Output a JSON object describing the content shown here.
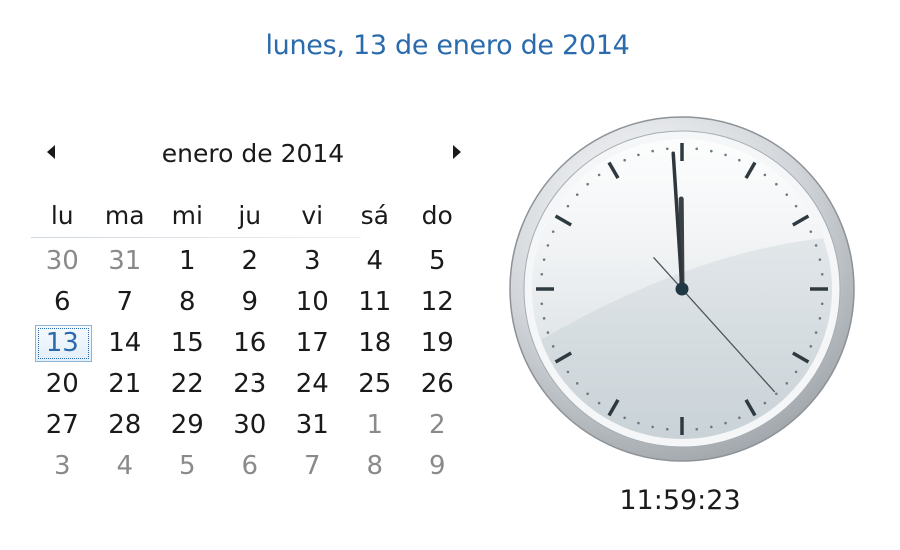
{
  "header": {
    "long_date": "lunes, 13 de enero de 2014"
  },
  "calendar": {
    "month_title": "enero de 2014",
    "prev_icon": "triangle-left-icon",
    "next_icon": "triangle-right-icon",
    "weekdays": [
      "lu",
      "ma",
      "mi",
      "ju",
      "vi",
      "sá",
      "do"
    ],
    "weeks": [
      [
        "30",
        "31",
        "1",
        "2",
        "3",
        "4",
        "5"
      ],
      [
        "6",
        "7",
        "8",
        "9",
        "10",
        "11",
        "12"
      ],
      [
        "13",
        "14",
        "15",
        "16",
        "17",
        "18",
        "19"
      ],
      [
        "20",
        "21",
        "22",
        "23",
        "24",
        "25",
        "26"
      ],
      [
        "27",
        "28",
        "29",
        "30",
        "31",
        "1",
        "2"
      ],
      [
        "3",
        "4",
        "5",
        "6",
        "7",
        "8",
        "9"
      ]
    ],
    "outside_month": [
      [
        true,
        true,
        false,
        false,
        false,
        false,
        false
      ],
      [
        false,
        false,
        false,
        false,
        false,
        false,
        false
      ],
      [
        false,
        false,
        false,
        false,
        false,
        false,
        false
      ],
      [
        false,
        false,
        false,
        false,
        false,
        false,
        false
      ],
      [
        false,
        false,
        false,
        false,
        false,
        true,
        true
      ],
      [
        true,
        true,
        true,
        true,
        true,
        true,
        true
      ]
    ],
    "today": {
      "week": 2,
      "day": 0
    }
  },
  "clock": {
    "time": "11:59:23",
    "hours": 11,
    "minutes": 59,
    "seconds": 23
  },
  "colors": {
    "accent": "#2a6aad",
    "text": "#1a1a1a",
    "muted": "#8a8a8a"
  }
}
